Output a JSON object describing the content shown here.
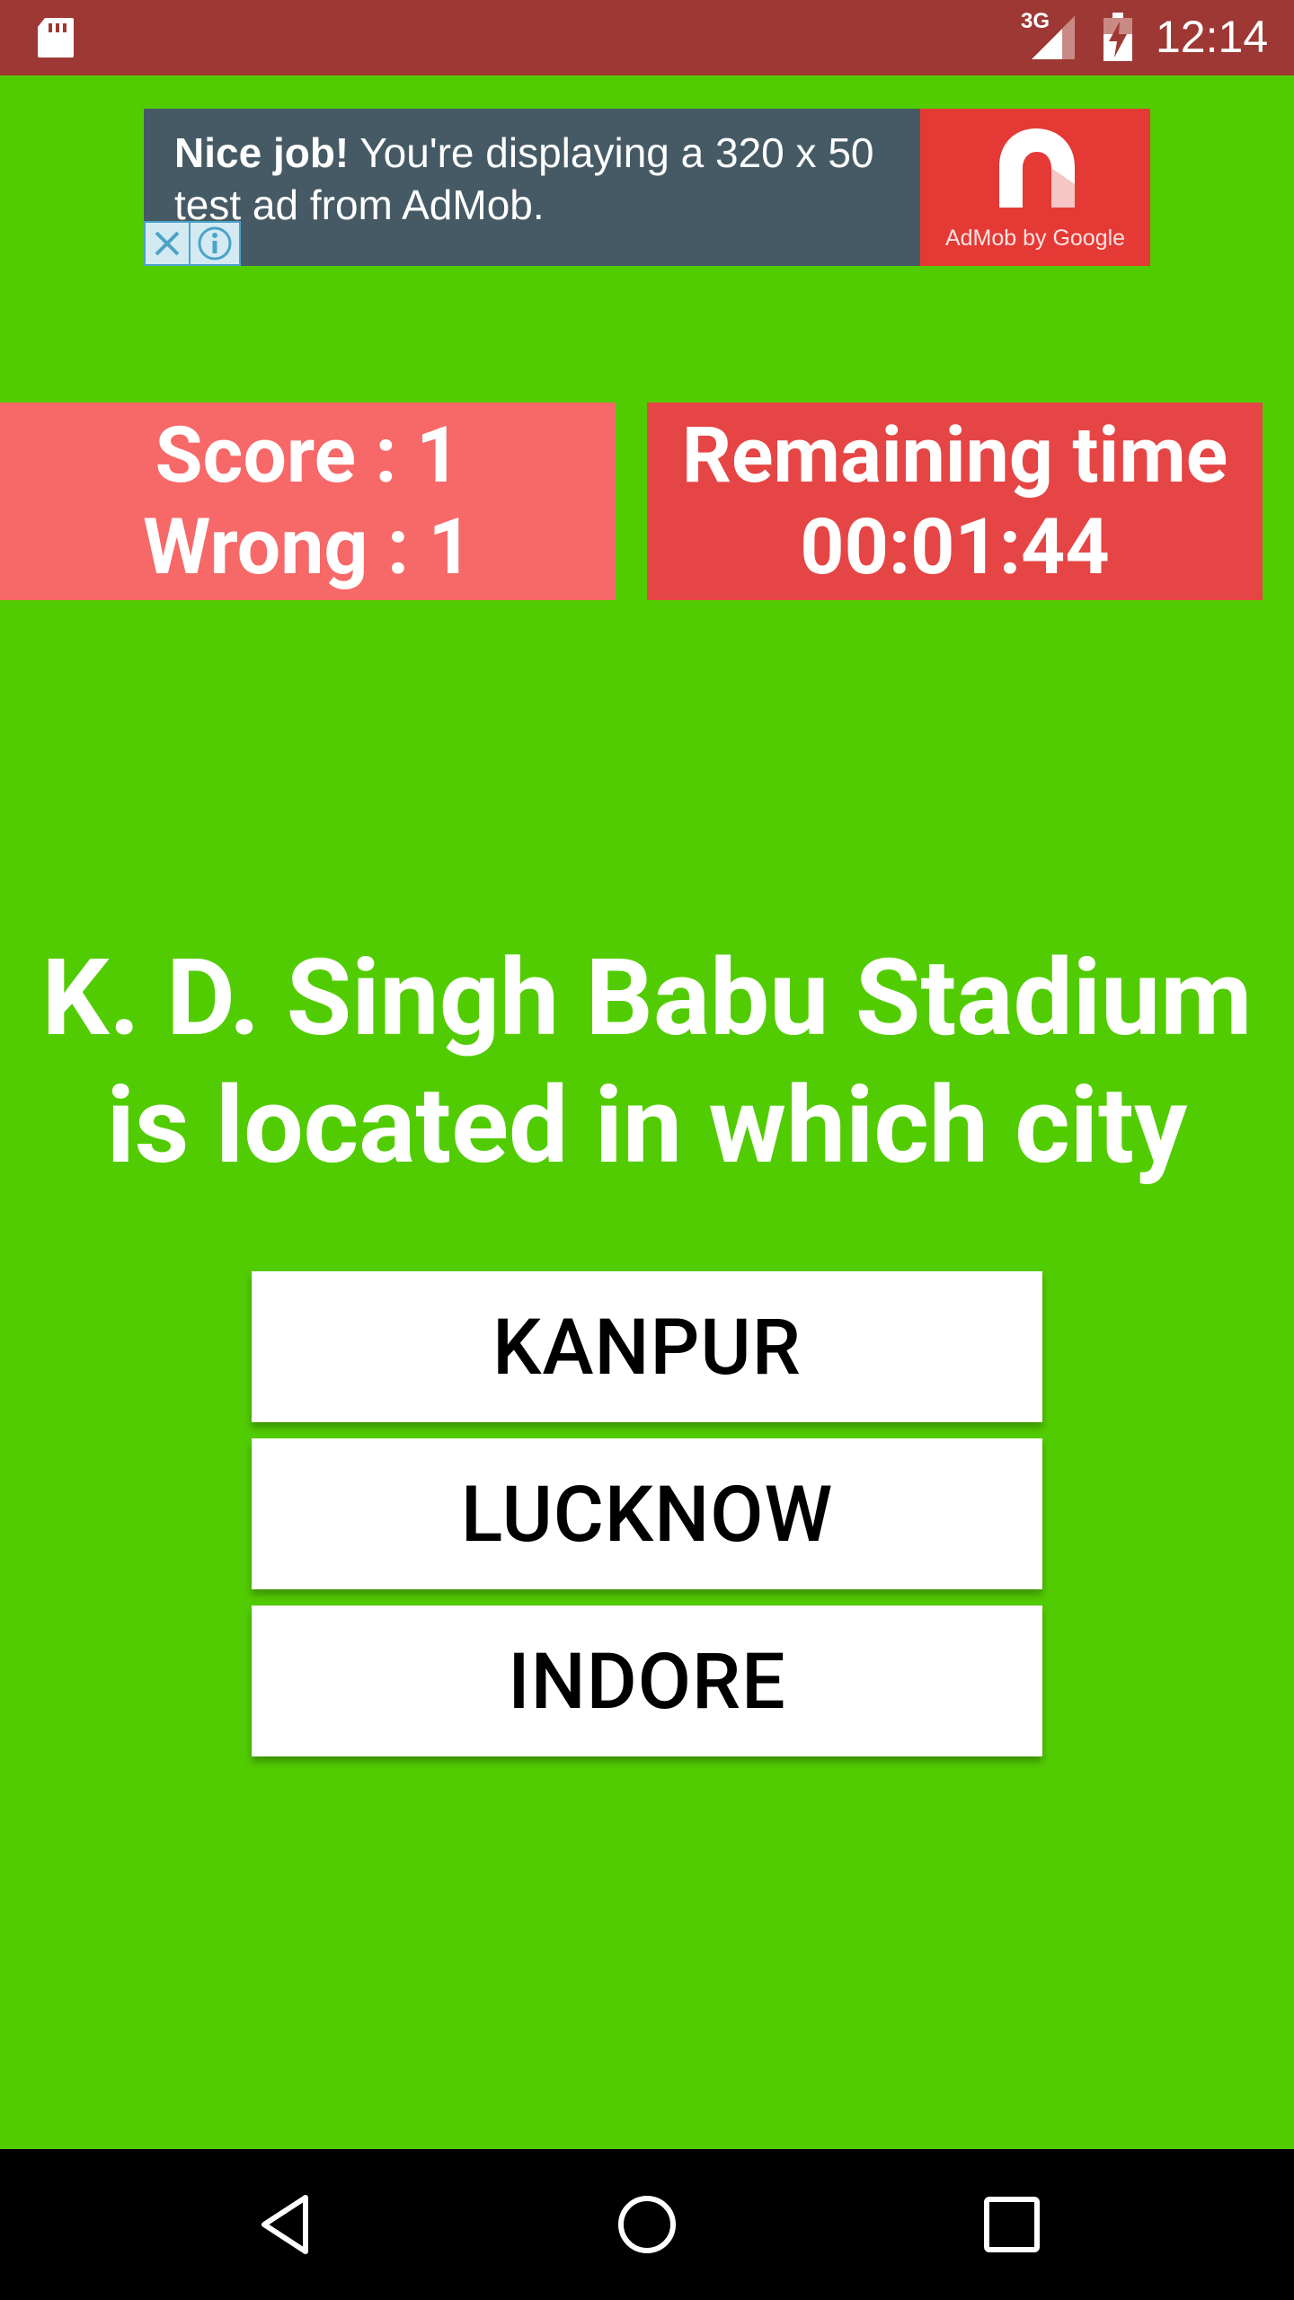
{
  "status_bar": {
    "time": "12:14",
    "network": "3G",
    "icons": [
      "sd-card-icon",
      "signal-icon",
      "battery-charging-icon"
    ]
  },
  "ad": {
    "headline_bold": "Nice job!",
    "headline_rest": " You're displaying a 320 x 50 test ad from AdMob.",
    "brand_caption": "AdMob by Google",
    "close_icon": "close-icon",
    "info_icon": "info-icon",
    "colors": {
      "background": "#455a64",
      "logo_bg": "#e53935"
    }
  },
  "score": {
    "score_text": "Score : 1",
    "wrong_text": "Wrong : 1"
  },
  "timer": {
    "label": "Remaining time",
    "value": "00:01:44"
  },
  "question": {
    "line1": "K. D. Singh Babu Stadium",
    "line2": "is located in which city"
  },
  "answers": [
    {
      "label": "KANPUR"
    },
    {
      "label": "LUCKNOW"
    },
    {
      "label": "INDORE"
    }
  ],
  "nav": {
    "icons": [
      "back-icon",
      "home-icon",
      "recents-icon"
    ]
  },
  "colors": {
    "background": "#52cc02",
    "status_bar": "#9e3834",
    "score_box": "#f76868",
    "time_box": "#e64545"
  }
}
